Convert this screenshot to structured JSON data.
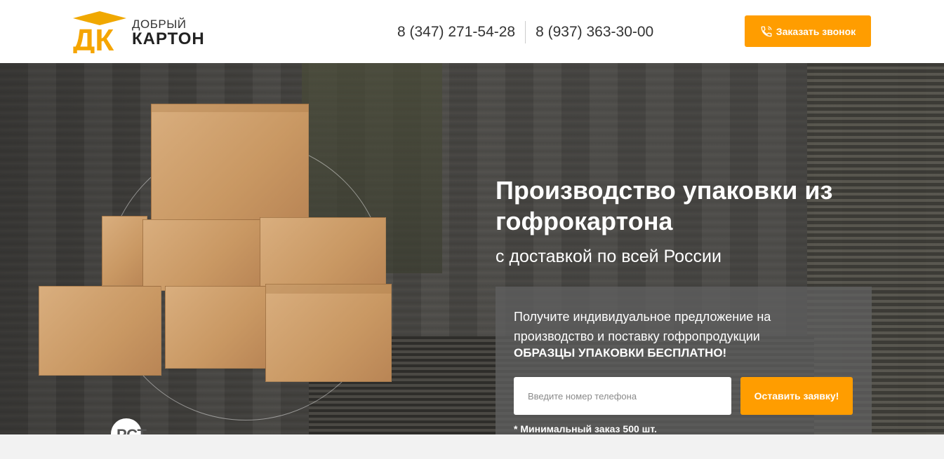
{
  "header": {
    "logo": {
      "letters": "ДК",
      "line1": "ДОБРЫЙ",
      "line2": "КАРТОН"
    },
    "phones": [
      "8 (347) 271-54-28",
      "8 (937) 363-30-00"
    ],
    "callback_label": "Заказать звонок",
    "callback_icon": "phone-icon",
    "accent": "#ff9d00"
  },
  "hero": {
    "title": "Производство упаковки из гофрокартона",
    "subtitle": "с доставкой по всей России",
    "certification_mark": "РСТ",
    "offer": {
      "text": "Получите индивидуальное предложение на производство и поставку гофропродукции",
      "bold": "ОБРАЗЦЫ УПАКОВКИ БЕСПЛАТНО!",
      "phone_placeholder": "Введите номер телефона",
      "phone_value": "",
      "submit_label": "Оставить заявку!",
      "min_order": "* Минимальный заказ 500 шт."
    }
  }
}
